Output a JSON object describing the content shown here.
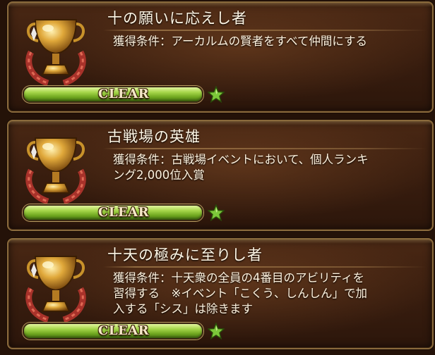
{
  "achievements": [
    {
      "title": "十の願いに応えし者",
      "condition_lines": [
        "獲得条件：アーカルムの賢者をすべて仲間にする"
      ],
      "status": "CLEAR",
      "icon": "trophy-icon",
      "star_icon": "star-icon"
    },
    {
      "title": "古戦場の英雄",
      "condition_lines": [
        "獲得条件：古戦場イベントにおいて、個人ランキ",
        "ング2,000位入賞"
      ],
      "status": "CLEAR",
      "icon": "trophy-icon",
      "star_icon": "star-icon"
    },
    {
      "title": "十天の極みに至りし者",
      "condition_lines": [
        "獲得条件：十天衆の全員の4番目のアビリティを",
        "習得する　※イベント「こくう、しんしん」で加",
        "入する「シス」は除きます"
      ],
      "status": "CLEAR",
      "icon": "trophy-icon",
      "star_icon": "star-icon"
    }
  ],
  "colors": {
    "clear_bar": "#8cc23a",
    "star": "#7cc83a",
    "text": "#fff3df",
    "frame": "#8a6a3c"
  }
}
